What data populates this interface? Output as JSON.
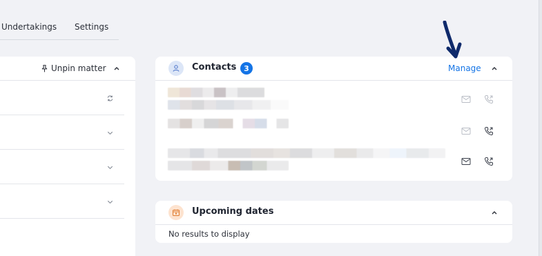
{
  "tabs": [
    {
      "label": "Undertakings"
    },
    {
      "label": "Settings"
    }
  ],
  "left_panel": {
    "unpin_label": "Unpin matter"
  },
  "contacts": {
    "title": "Contacts",
    "count": "3",
    "manage_label": "Manage"
  },
  "upcoming_dates": {
    "title": "Upcoming dates",
    "empty_text": "No results to display"
  },
  "colors": {
    "accent": "#1474e6",
    "arrow": "#0f2a6b",
    "background": "#f1f2f6"
  }
}
